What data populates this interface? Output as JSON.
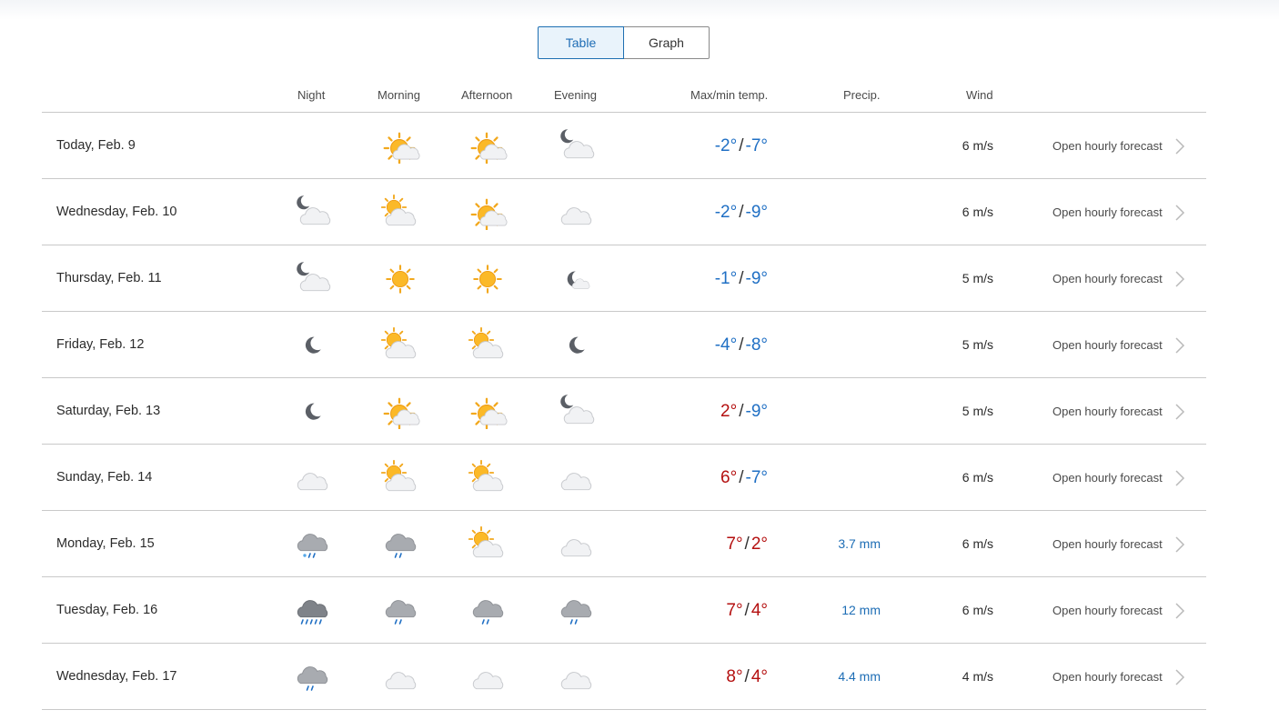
{
  "view_toggle": {
    "table_label": "Table",
    "graph_label": "Graph",
    "selected": "Table"
  },
  "headers": {
    "night": "Night",
    "morning": "Morning",
    "afternoon": "Afternoon",
    "evening": "Evening",
    "temp": "Max/min temp.",
    "precip": "Precip.",
    "wind": "Wind"
  },
  "colors": {
    "warm": "#b40f0f",
    "cold": "#1f6fc4",
    "precip": "#1d6db5",
    "accent": "#1e6fb2"
  },
  "rows": [
    {
      "date": "Today, Feb. 9",
      "icons": [
        "",
        "partly-sunny-icon",
        "partly-sunny-icon",
        "partly-cloudy-night-icon"
      ],
      "max": "-2°",
      "max_warm": false,
      "min": "-7°",
      "min_warm": false,
      "precip": "",
      "wind": "6 m/s",
      "link": "Open hourly forecast"
    },
    {
      "date": "Wednesday, Feb. 10",
      "icons": [
        "partly-cloudy-night-icon",
        "sun-behind-cloud-icon",
        "partly-sunny-icon",
        "cloud-icon"
      ],
      "max": "-2°",
      "max_warm": false,
      "min": "-9°",
      "min_warm": false,
      "precip": "",
      "wind": "6 m/s",
      "link": "Open hourly forecast"
    },
    {
      "date": "Thursday, Feb. 11",
      "icons": [
        "partly-cloudy-night-icon",
        "sun-icon",
        "sun-icon",
        "moon-small-cloud-icon"
      ],
      "max": "-1°",
      "max_warm": false,
      "min": "-9°",
      "min_warm": false,
      "precip": "",
      "wind": "5 m/s",
      "link": "Open hourly forecast"
    },
    {
      "date": "Friday, Feb. 12",
      "icons": [
        "moon-icon",
        "sun-behind-cloud-icon",
        "sun-behind-cloud-icon",
        "moon-icon"
      ],
      "max": "-4°",
      "max_warm": false,
      "min": "-8°",
      "min_warm": false,
      "precip": "",
      "wind": "5 m/s",
      "link": "Open hourly forecast"
    },
    {
      "date": "Saturday, Feb. 13",
      "icons": [
        "moon-icon",
        "partly-sunny-icon",
        "partly-sunny-icon",
        "partly-cloudy-night-icon"
      ],
      "max": "2°",
      "max_warm": true,
      "min": "-9°",
      "min_warm": false,
      "precip": "",
      "wind": "5 m/s",
      "link": "Open hourly forecast"
    },
    {
      "date": "Sunday, Feb. 14",
      "icons": [
        "cloud-icon",
        "sun-behind-cloud-icon",
        "sun-behind-cloud-icon",
        "cloud-icon"
      ],
      "max": "6°",
      "max_warm": true,
      "min": "-7°",
      "min_warm": false,
      "precip": "",
      "wind": "6 m/s",
      "link": "Open hourly forecast"
    },
    {
      "date": "Monday, Feb. 15",
      "icons": [
        "sleet-icon",
        "rain-icon",
        "sun-behind-cloud-icon",
        "cloud-icon"
      ],
      "max": "7°",
      "max_warm": true,
      "min": "2°",
      "min_warm": true,
      "precip": "3.7 mm",
      "wind": "6 m/s",
      "link": "Open hourly forecast"
    },
    {
      "date": "Tuesday, Feb. 16",
      "icons": [
        "heavy-rain-icon",
        "rain-icon",
        "rain-icon",
        "rain-icon"
      ],
      "max": "7°",
      "max_warm": true,
      "min": "4°",
      "min_warm": true,
      "precip": "12 mm",
      "wind": "6 m/s",
      "link": "Open hourly forecast"
    },
    {
      "date": "Wednesday, Feb. 17",
      "icons": [
        "rain-icon",
        "cloud-icon",
        "cloud-icon",
        "cloud-icon"
      ],
      "max": "8°",
      "max_warm": true,
      "min": "4°",
      "min_warm": true,
      "precip": "4.4 mm",
      "wind": "4 m/s",
      "link": "Open hourly forecast"
    }
  ]
}
